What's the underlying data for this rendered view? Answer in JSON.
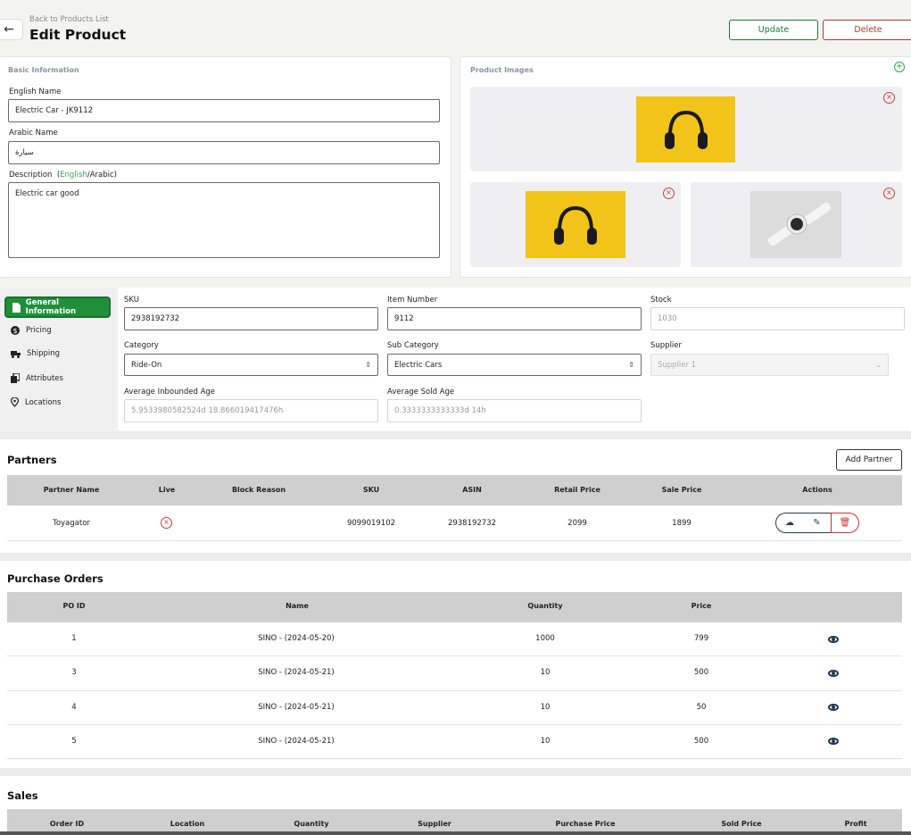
{
  "header": {
    "back_link": "Back to Products List",
    "title": "Edit Product",
    "update_label": "Update",
    "delete_label": "Delete"
  },
  "basic_info": {
    "section_title": "Basic Information",
    "english_name_label": "English Name",
    "english_name_value": "Electric Car - JK9112",
    "arabic_name_label": "Arabic Name",
    "arabic_name_value": "سيارة",
    "description_label": "Description",
    "description_lang_active": "English",
    "description_lang_sep": "/Arabic)",
    "description_lang_open": "(",
    "description_value": "Electric car good"
  },
  "images": {
    "section_title": "Product Images",
    "items": [
      "headphones",
      "headphones",
      "smartwatch"
    ]
  },
  "nav": {
    "items": [
      {
        "label": "General Information",
        "icon": "document-icon",
        "active": true
      },
      {
        "label": "Pricing",
        "icon": "dollar-icon"
      },
      {
        "label": "Shipping",
        "icon": "truck-icon"
      },
      {
        "label": "Attributes",
        "icon": "copy-icon"
      },
      {
        "label": "Locations",
        "icon": "pin-icon"
      }
    ]
  },
  "general": {
    "sku_label": "SKU",
    "sku_value": "2938192732",
    "item_number_label": "Item Number",
    "item_number_value": "9112",
    "stock_label": "Stock",
    "stock_value": "1030",
    "category_label": "Category",
    "category_value": "Ride-On",
    "sub_category_label": "Sub Category",
    "sub_category_value": "Electric Cars",
    "supplier_label": "Supplier",
    "supplier_value": "Supplier 1",
    "avg_inbound_label": "Average Inbounded Age",
    "avg_inbound_value": "5.9533980582524d 18.866019417476h",
    "avg_sold_label": "Average Sold Age",
    "avg_sold_value": "0.3333333333333d 14h"
  },
  "partners": {
    "title": "Partners",
    "add_label": "Add Partner",
    "columns": [
      "Partner Name",
      "Live",
      "Block Reason",
      "SKU",
      "ASIN",
      "Retail Price",
      "Sale Price",
      "Actions"
    ],
    "rows": [
      {
        "name": "Toyagator",
        "block_reason": "",
        "sku": "9099019102",
        "asin": "2938192732",
        "retail": "2099",
        "sale": "1899"
      }
    ]
  },
  "purchase_orders": {
    "title": "Purchase Orders",
    "columns": [
      "PO ID",
      "Name",
      "Quantity",
      "Price"
    ],
    "rows": [
      {
        "id": "1",
        "name": "SINO - (2024-05-20)",
        "qty": "1000",
        "price": "799"
      },
      {
        "id": "3",
        "name": "SINO - (2024-05-21)",
        "qty": "10",
        "price": "500"
      },
      {
        "id": "4",
        "name": "SINO - (2024-05-21)",
        "qty": "10",
        "price": "50"
      },
      {
        "id": "5",
        "name": "SINO - (2024-05-21)",
        "qty": "10",
        "price": "500"
      }
    ]
  },
  "sales": {
    "title": "Sales",
    "columns": [
      "Order ID",
      "Location",
      "Quantity",
      "Supplier",
      "Purchase Price",
      "Sold Price",
      "Profit"
    ]
  },
  "colors": {
    "accent": "#1f8f3a",
    "danger": "#d43a3a",
    "table_header": "#cfcfcf"
  }
}
